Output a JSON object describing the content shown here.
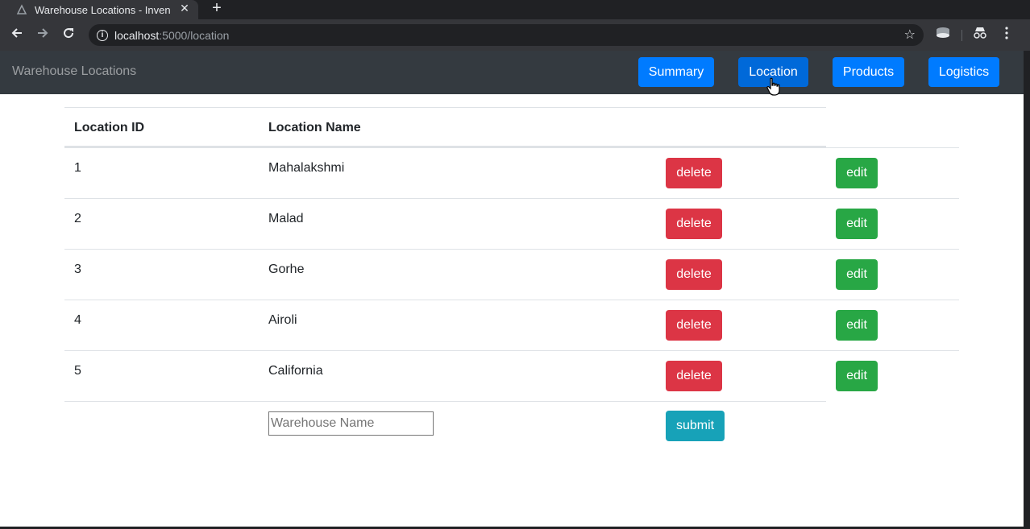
{
  "browser": {
    "tab_title": "Warehouse Locations - Inven",
    "tab_close": "✕",
    "new_tab": "+",
    "url_host": "localhost",
    "url_path": ":5000/location"
  },
  "navbar": {
    "brand": "Warehouse Locations",
    "links": [
      {
        "label": "Summary"
      },
      {
        "label": "Location"
      },
      {
        "label": "Products"
      },
      {
        "label": "Logistics"
      }
    ],
    "active": "Location"
  },
  "table": {
    "headers": [
      "Location ID",
      "Location Name"
    ],
    "rows": [
      {
        "id": "1",
        "name": "Mahalakshmi",
        "delete_label": "delete",
        "edit_label": "edit"
      },
      {
        "id": "2",
        "name": "Malad",
        "delete_label": "delete",
        "edit_label": "edit"
      },
      {
        "id": "3",
        "name": "Gorhe",
        "delete_label": "delete",
        "edit_label": "edit"
      },
      {
        "id": "4",
        "name": "Airoli",
        "delete_label": "delete",
        "edit_label": "edit"
      },
      {
        "id": "5",
        "name": "California",
        "delete_label": "delete",
        "edit_label": "edit"
      }
    ]
  },
  "form": {
    "placeholder": "Warehouse Name",
    "submit_label": "submit"
  },
  "colors": {
    "navbar": "#343a40",
    "primary": "#007bff",
    "danger": "#dc3545",
    "success": "#28a745",
    "info": "#17a2b8"
  }
}
